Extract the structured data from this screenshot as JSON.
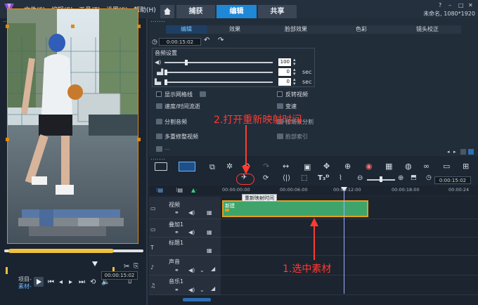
{
  "menu": {
    "items": [
      "文件(F)",
      "编辑(E)",
      "工具(T)",
      "设置(S)",
      "帮助(H)"
    ]
  },
  "tabs": [
    {
      "label": "捕获",
      "active": false
    },
    {
      "label": "编辑",
      "active": true
    },
    {
      "label": "共享",
      "active": false
    }
  ],
  "project_info": "未命名, 1080*1920",
  "preview": {
    "mode_label": "项目-",
    "mode_label2": "素材-",
    "timecode": "00:00:15:02"
  },
  "options": {
    "tabs": [
      "编辑",
      "效果",
      "脸部效果",
      "色彩",
      "镜头校正"
    ],
    "active_tab": "编辑",
    "duration": "0:00:15:02",
    "audio_title": "音频设置",
    "volume": "100",
    "fade_in": "0",
    "fade_out": "0",
    "sec_label": "sec",
    "items_left": [
      "显示网格线",
      "速度/时间流逝",
      "分割音频",
      "多重修整视频",
      "..."
    ],
    "items_right": [
      "反转视频",
      "变速",
      "按场景分割",
      "脸部索引"
    ]
  },
  "timeline": {
    "timecode": "0:00:15:02",
    "ruler_labels": [
      "00:00:00:00",
      "00:00:06:00",
      "00:00:12:00",
      "00:00:18:00",
      "00:00:24"
    ],
    "tracks": [
      {
        "name": "视频",
        "icon": "video-track-icon"
      },
      {
        "name": "叠加1",
        "icon": "overlay-track-icon"
      },
      {
        "name": "标题1",
        "icon": "title-track-icon"
      },
      {
        "name": "声音",
        "icon": "voice-track-icon"
      },
      {
        "name": "音乐1",
        "icon": "music-track-icon"
      }
    ],
    "clip_label": "新建",
    "tooltip": "重新映射时间"
  },
  "annotations": {
    "step1": "1.选中素材",
    "step2": "2.打开重新映射时间"
  },
  "colors": {
    "accent": "#1e87d6",
    "annotation": "#ff3b30",
    "clip": "#3fa46a",
    "clip_border": "#e0a020"
  }
}
